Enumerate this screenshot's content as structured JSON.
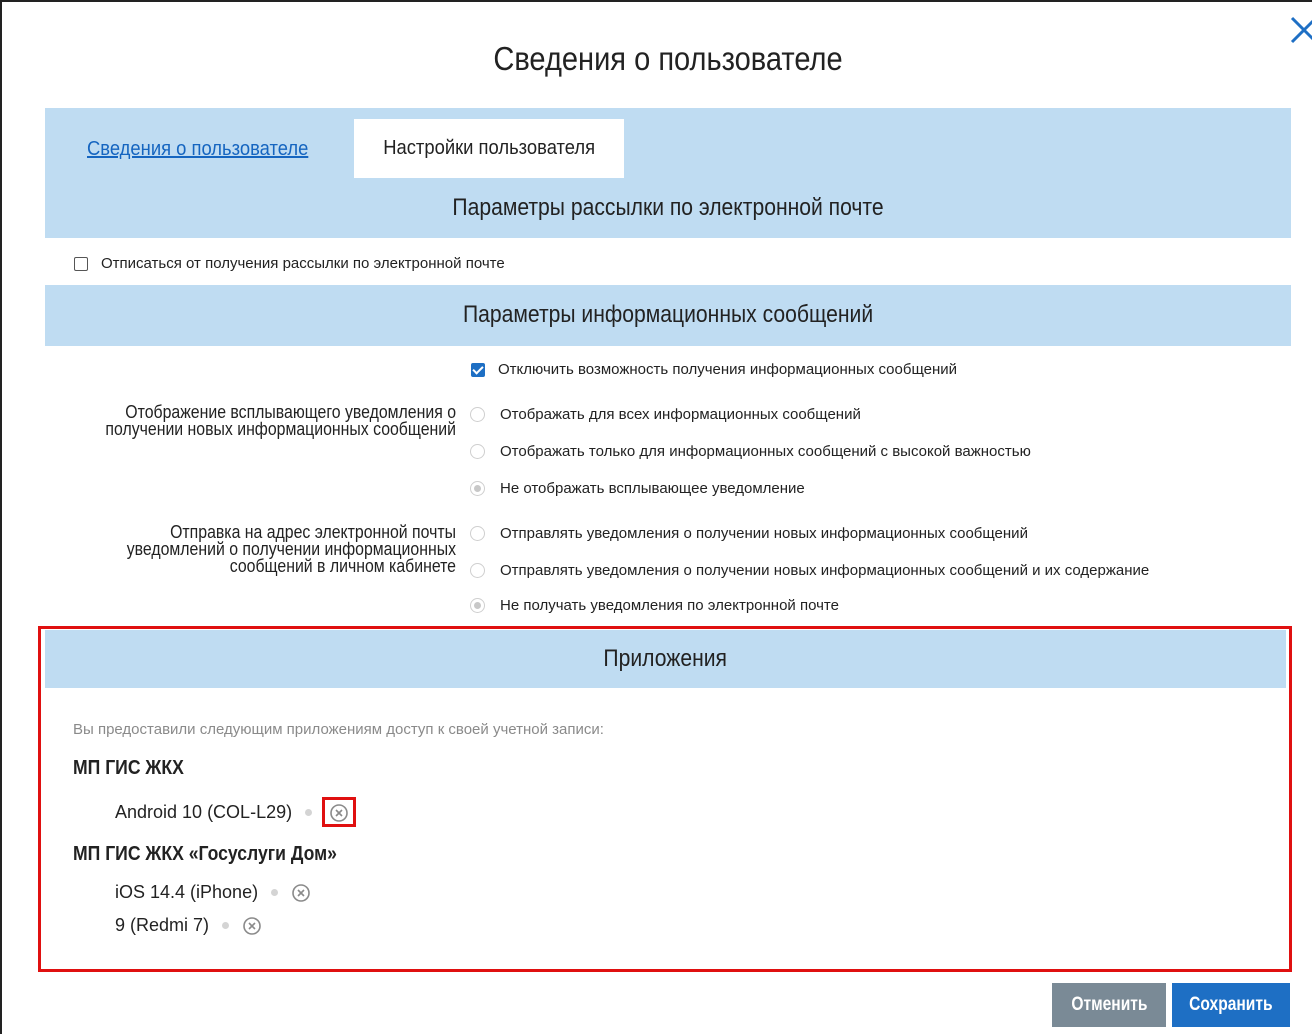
{
  "modal": {
    "title": "Сведения о пользователе"
  },
  "tabs": [
    {
      "label": "Сведения о пользователе",
      "active": false
    },
    {
      "label": "Настройки пользователя",
      "active": true
    }
  ],
  "email_section": {
    "title": "Параметры рассылки по электронной почте",
    "unsubscribe_label": "Отписаться от получения рассылки по электронной почте",
    "unsubscribe_checked": false
  },
  "info_section": {
    "title": "Параметры информационных сообщений",
    "disable_label": "Отключить возможность получения информационных сообщений",
    "disable_checked": true,
    "popup_group": {
      "label": "Отображение всплывающего уведомления о получении новых информационных сообщений",
      "options": [
        {
          "label": "Отображать для всех информационных сообщений",
          "selected": false
        },
        {
          "label": "Отображать только для информационных сообщений с высокой важностью",
          "selected": false
        },
        {
          "label": "Не отображать всплывающее уведомление",
          "selected": true
        }
      ]
    },
    "email_group": {
      "label": "Отправка на адрес электронной почты уведомлений о получении информационных сообщений в личном кабинете",
      "options": [
        {
          "label": "Отправлять уведомления о получении новых информационных сообщений",
          "selected": false
        },
        {
          "label": "Отправлять уведомления о получении новых информационных сообщений и их содержание",
          "selected": false
        },
        {
          "label": "Не получать уведомления по электронной почте",
          "selected": true
        }
      ]
    }
  },
  "apps_section": {
    "title": "Приложения",
    "note": "Вы предоставили следующим приложениям доступ к своей учетной записи:",
    "apps": [
      {
        "name": "МП ГИС ЖКХ",
        "devices": [
          "Android 10 (COL-L29)"
        ]
      },
      {
        "name": "МП ГИС ЖКХ «Госуслуги Дом»",
        "devices": [
          "iOS 14.4 (iPhone)",
          "9 (Redmi 7)"
        ]
      }
    ]
  },
  "buttons": {
    "cancel": "Отменить",
    "save": "Сохранить"
  },
  "colors": {
    "header_bg": "#bfdcf2",
    "primary": "#1e6fc4",
    "secondary": "#7a8a96",
    "highlight": "#e01010"
  }
}
